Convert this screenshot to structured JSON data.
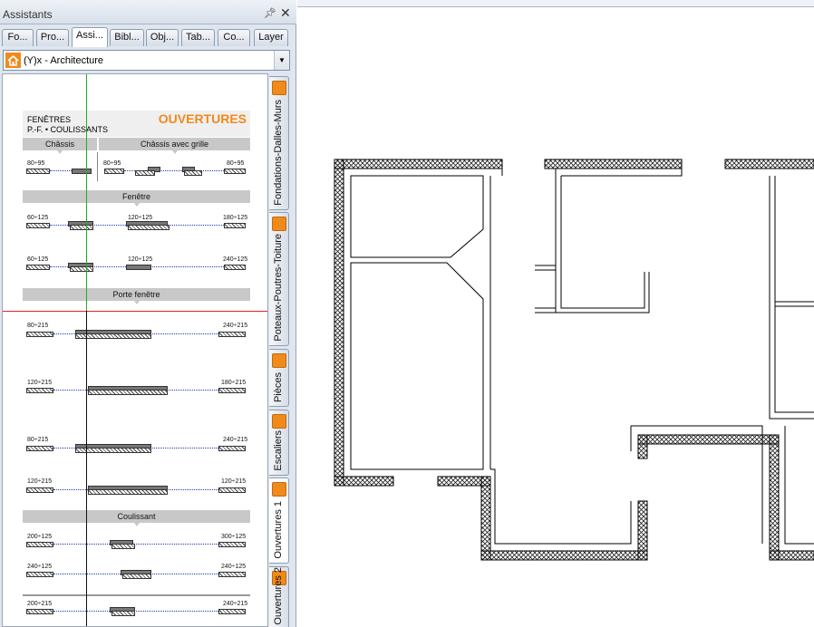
{
  "panel": {
    "title": "Assistants",
    "pin_icon": "pin-icon",
    "close_icon": "close-icon",
    "tabs": [
      "Fo...",
      "Pro...",
      "Assi...",
      "Bibl...",
      "Obj...",
      "Tab...",
      "Co...",
      "Layer"
    ],
    "active_tab": 2,
    "combo": {
      "value": "(Y)x - Architecture",
      "icon": "home-icon"
    },
    "side_tabs": [
      "Fondations-Dalles-Murs",
      "Poteaux-Poutres-Toiture",
      "Pièces",
      "Escaliers",
      "Ouvertures 1",
      "Ouvertures 2"
    ],
    "active_side_tab": 4
  },
  "sheet": {
    "brand": "OUVERTURES",
    "subtitle1": "FENÊTRES",
    "subtitle2": "P.-F. • COULISSANTS",
    "sections": {
      "chassis": "Châssis",
      "chassis_grille": "Châssis avec grille",
      "fenetre": "Fenêtre",
      "porte_fenetre": "Porte fenêtre",
      "coulissant": "Coulissant"
    },
    "labels": {
      "r1a": "80÷95",
      "r1b": "80÷95",
      "r1c": "80÷95",
      "r2a": "60÷125",
      "r2b": "120÷125",
      "r2c": "180÷125",
      "r3a": "60÷125",
      "r3b": "120÷125",
      "r3c": "240÷125",
      "r4a": "80÷215",
      "r4b": "240÷215",
      "r5a": "120÷215",
      "r5b": "180÷215",
      "r6a": "80÷215",
      "r6b": "240÷215",
      "r7a": "120÷215",
      "r7b": "120÷215",
      "r8a": "200÷125",
      "r8b": "300÷125",
      "r9a": "240÷125",
      "r9b": "240÷125",
      "r10a": "200÷215",
      "r10b": "240÷215"
    }
  },
  "colors": {
    "accent": "#f08a1a",
    "cursor_red": "#e02020",
    "cursor_green": "#22aa22"
  }
}
